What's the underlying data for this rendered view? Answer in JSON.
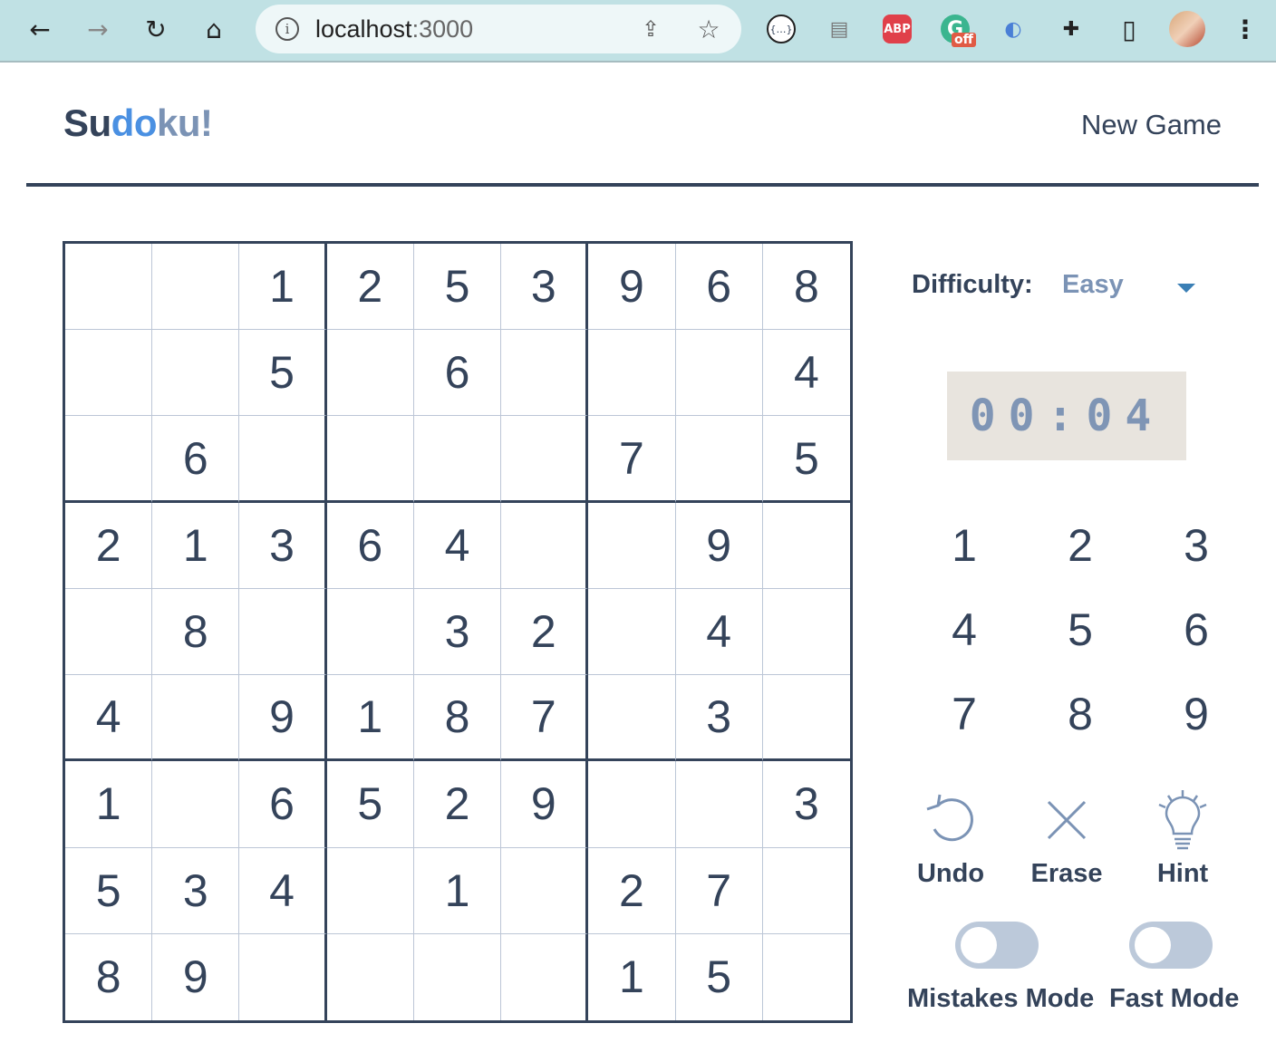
{
  "browser": {
    "url_host": "localhost",
    "url_port": ":3000",
    "extensions": [
      {
        "name": "json-viewer-icon",
        "glyph": "{…}"
      },
      {
        "name": "document-extension-icon",
        "glyph": "▤"
      },
      {
        "name": "adblock-icon",
        "glyph": "ABP"
      },
      {
        "name": "grammarly-icon",
        "glyph": "G",
        "badge": "off"
      },
      {
        "name": "password-lock-icon",
        "glyph": "◐"
      },
      {
        "name": "puzzle-icon",
        "glyph": "✚"
      },
      {
        "name": "sidepanel-icon",
        "glyph": "▯"
      }
    ]
  },
  "header": {
    "logo_part1": "Su",
    "logo_part2": "do",
    "logo_part3": "ku!",
    "new_game": "New Game"
  },
  "colors": {
    "primary": "#34435a",
    "accent": "#4a90e2",
    "muted": "#7b93b5",
    "timer_bg": "#e8e4de"
  },
  "board": [
    [
      "",
      "",
      "1",
      "2",
      "5",
      "3",
      "9",
      "6",
      "8"
    ],
    [
      "",
      "",
      "5",
      "",
      "6",
      "",
      "",
      "",
      "4"
    ],
    [
      "",
      "6",
      "",
      "",
      "",
      "",
      "7",
      "",
      "5"
    ],
    [
      "2",
      "1",
      "3",
      "6",
      "4",
      "",
      "",
      "9",
      ""
    ],
    [
      "",
      "8",
      "",
      "",
      "3",
      "2",
      "",
      "4",
      ""
    ],
    [
      "4",
      "",
      "9",
      "1",
      "8",
      "7",
      "",
      "3",
      ""
    ],
    [
      "1",
      "",
      "6",
      "5",
      "2",
      "9",
      "",
      "",
      "3"
    ],
    [
      "5",
      "3",
      "4",
      "",
      "1",
      "",
      "2",
      "7",
      ""
    ],
    [
      "8",
      "9",
      "",
      "",
      "",
      "",
      "1",
      "5",
      ""
    ]
  ],
  "status": {
    "difficulty_label": "Difficulty:",
    "difficulty_value": "Easy",
    "timer": "00:04"
  },
  "numpad": [
    "1",
    "2",
    "3",
    "4",
    "5",
    "6",
    "7",
    "8",
    "9"
  ],
  "actions": {
    "undo": "Undo",
    "erase": "Erase",
    "hint": "Hint"
  },
  "toggles": {
    "mistakes_mode": {
      "label": "Mistakes Mode",
      "on": false
    },
    "fast_mode": {
      "label": "Fast Mode",
      "on": false
    }
  }
}
